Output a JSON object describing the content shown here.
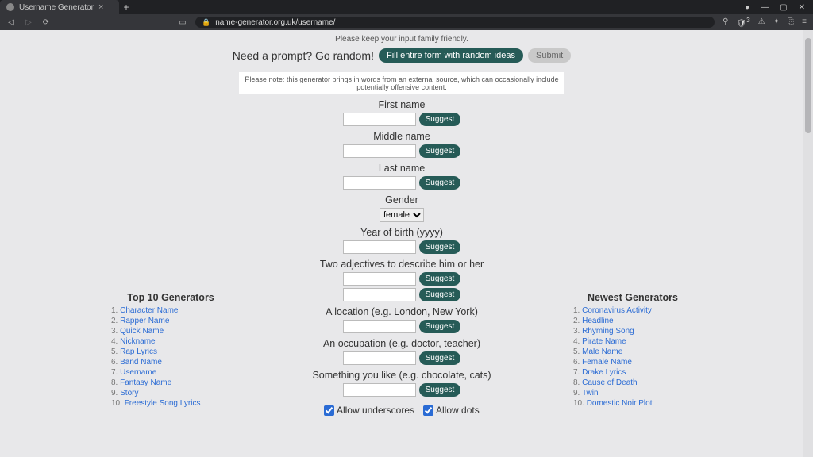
{
  "browser": {
    "tab_title": "Username Generator",
    "url_display": "name-generator.org.uk/username/",
    "ext_badge": "3"
  },
  "page": {
    "hint": "Please keep your input family friendly.",
    "prompt_prefix": "Need a prompt? Go random!",
    "fill_button": "Fill entire form with random ideas",
    "submit_button": "Submit",
    "notice": "Please note: this generator brings in words from an external source, which can occasionally include potentially offensive content."
  },
  "form": {
    "first_name": {
      "label": "First name",
      "value": "",
      "suggest": "Suggest"
    },
    "middle_name": {
      "label": "Middle name",
      "value": "",
      "suggest": "Suggest"
    },
    "last_name": {
      "label": "Last name",
      "value": "",
      "suggest": "Suggest"
    },
    "gender": {
      "label": "Gender",
      "value": "female"
    },
    "yob": {
      "label": "Year of birth (yyyy)",
      "value": "",
      "suggest": "Suggest"
    },
    "adjectives": {
      "label": "Two adjectives to describe him or her",
      "value1": "",
      "value2": "",
      "suggest": "Suggest"
    },
    "location": {
      "label": "A location (e.g. London, New York)",
      "value": "",
      "suggest": "Suggest"
    },
    "occupation": {
      "label": "An occupation (e.g. doctor, teacher)",
      "value": "",
      "suggest": "Suggest"
    },
    "like": {
      "label": "Something you like (e.g. chocolate, cats)",
      "value": "",
      "suggest": "Suggest"
    },
    "allow_underscores": {
      "label": "Allow underscores",
      "checked": true
    },
    "allow_dots": {
      "label": "Allow dots",
      "checked": true
    }
  },
  "top10": {
    "title": "Top 10 Generators",
    "items": [
      "Character Name",
      "Rapper Name",
      "Quick Name",
      "Nickname",
      "Rap Lyrics",
      "Band Name",
      "Username",
      "Fantasy Name",
      "Story",
      "Freestyle Song Lyrics"
    ]
  },
  "newest": {
    "title": "Newest Generators",
    "items": [
      "Coronavirus Activity",
      "Headline",
      "Rhyming Song",
      "Pirate Name",
      "Male Name",
      "Female Name",
      "Drake Lyrics",
      "Cause of Death",
      "Twin",
      "Domestic Noir Plot"
    ]
  }
}
